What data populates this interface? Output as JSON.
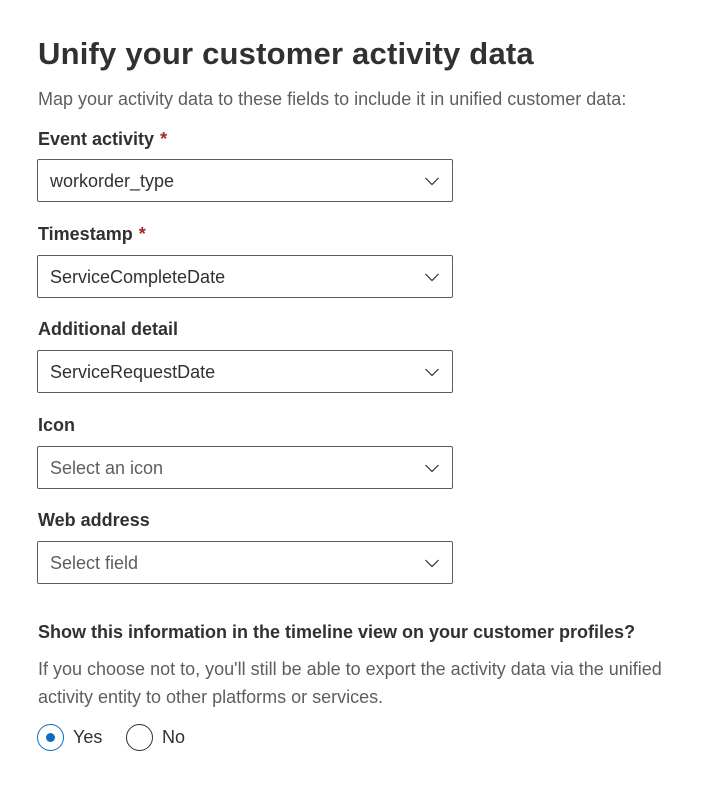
{
  "title": "Unify your customer activity data",
  "subtitle": "Map your activity data to these fields to include it in unified customer data:",
  "fields": [
    {
      "label": "Event activity",
      "required": "*",
      "value": "workorder_type"
    },
    {
      "label": "Timestamp",
      "required": "*",
      "value": "ServiceCompleteDate"
    },
    {
      "label": "Additional detail",
      "value": "ServiceRequestDate"
    },
    {
      "label": "Icon",
      "placeholder": "Select an icon"
    },
    {
      "label": "Web address",
      "placeholder": "Select field"
    }
  ],
  "timeline": {
    "question": "Show this information in the timeline view on your customer profiles?",
    "note": "If you choose not to, you'll still be able to export the activity data via the unified activity entity to other platforms or services.",
    "options": [
      {
        "label": "Yes",
        "selected": true
      },
      {
        "label": "No",
        "selected": false
      }
    ]
  },
  "colors": {
    "accent": "#0f6cbd",
    "required": "#a4262c",
    "text": "#323130",
    "secondary": "#605e5c"
  },
  "icons": {
    "dropdown": "chevron-down-icon"
  }
}
